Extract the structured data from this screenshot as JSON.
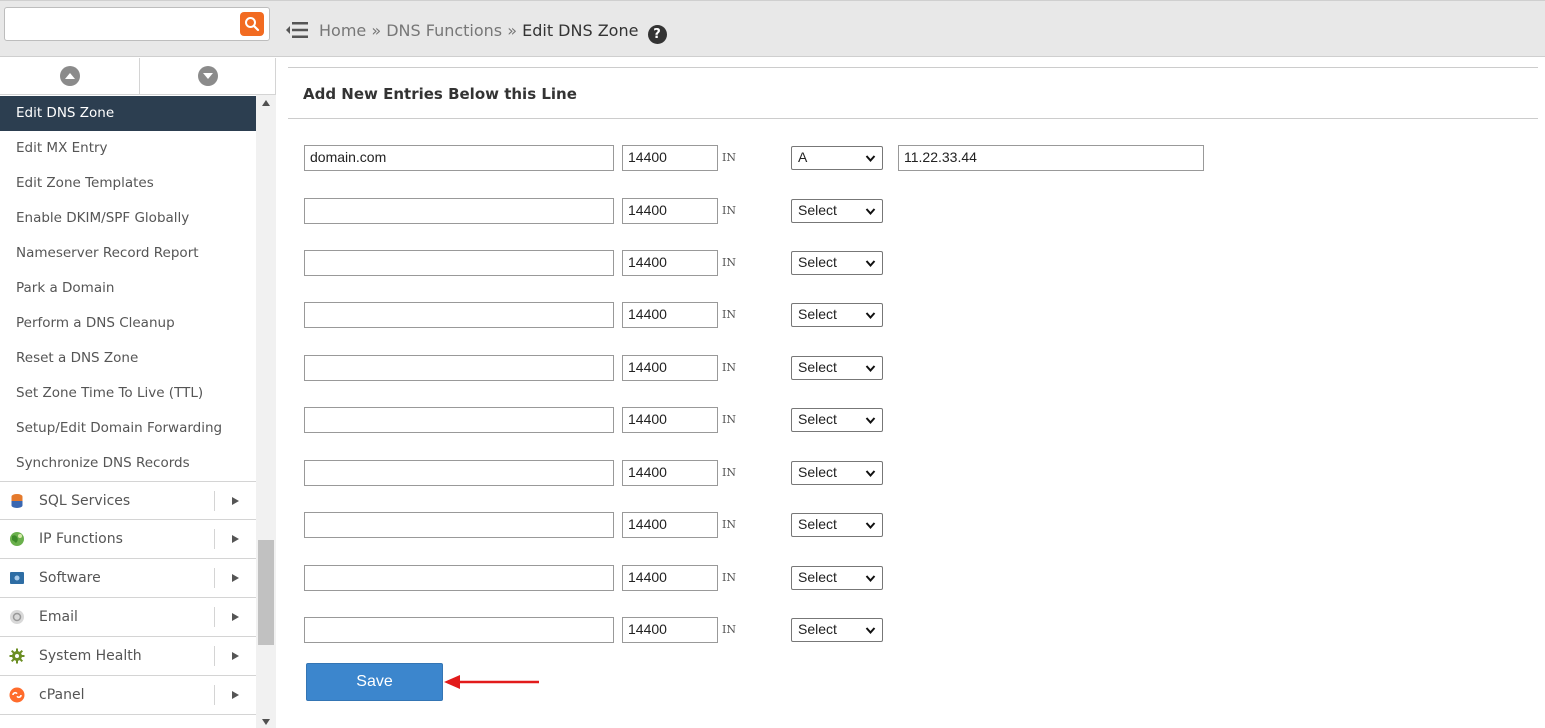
{
  "search": {
    "placeholder": ""
  },
  "breadcrumb": {
    "home": "Home",
    "sep1": " » ",
    "parent": "DNS Functions",
    "sep2": " » ",
    "current": "Edit DNS Zone"
  },
  "sidebar": {
    "items": [
      {
        "label": "Edit DNS Zone",
        "active": true
      },
      {
        "label": "Edit MX Entry"
      },
      {
        "label": "Edit Zone Templates"
      },
      {
        "label": "Enable DKIM/SPF Globally"
      },
      {
        "label": "Nameserver Record Report"
      },
      {
        "label": "Park a Domain"
      },
      {
        "label": "Perform a DNS Cleanup"
      },
      {
        "label": "Reset a DNS Zone"
      },
      {
        "label": "Set Zone Time To Live (TTL)"
      },
      {
        "label": "Setup/Edit Domain Forwarding"
      },
      {
        "label": "Synchronize DNS Records"
      }
    ],
    "groups": [
      {
        "label": "SQL Services",
        "icon": "database-icon"
      },
      {
        "label": "IP Functions",
        "icon": "globe-icon"
      },
      {
        "label": "Software",
        "icon": "software-icon"
      },
      {
        "label": "Email",
        "icon": "email-icon"
      },
      {
        "label": "System Health",
        "icon": "gear-icon"
      },
      {
        "label": "cPanel",
        "icon": "cpanel-icon"
      }
    ]
  },
  "main": {
    "section_title": "Add New Entries Below this Line",
    "rows": [
      {
        "name": "domain.com",
        "ttl": "14400",
        "class": "IN",
        "type": "A",
        "value": "11.22.33.44"
      },
      {
        "name": "",
        "ttl": "14400",
        "class": "IN",
        "type": "Select"
      },
      {
        "name": "",
        "ttl": "14400",
        "class": "IN",
        "type": "Select"
      },
      {
        "name": "",
        "ttl": "14400",
        "class": "IN",
        "type": "Select"
      },
      {
        "name": "",
        "ttl": "14400",
        "class": "IN",
        "type": "Select"
      },
      {
        "name": "",
        "ttl": "14400",
        "class": "IN",
        "type": "Select"
      },
      {
        "name": "",
        "ttl": "14400",
        "class": "IN",
        "type": "Select"
      },
      {
        "name": "",
        "ttl": "14400",
        "class": "IN",
        "type": "Select"
      },
      {
        "name": "",
        "ttl": "14400",
        "class": "IN",
        "type": "Select"
      },
      {
        "name": "",
        "ttl": "14400",
        "class": "IN",
        "type": "Select"
      }
    ],
    "save_label": "Save"
  },
  "colors": {
    "accent": "#f26b21",
    "active_nav": "#2c3e50",
    "save_button": "#3c86cd",
    "pointer_arrow": "#e21b1b"
  }
}
